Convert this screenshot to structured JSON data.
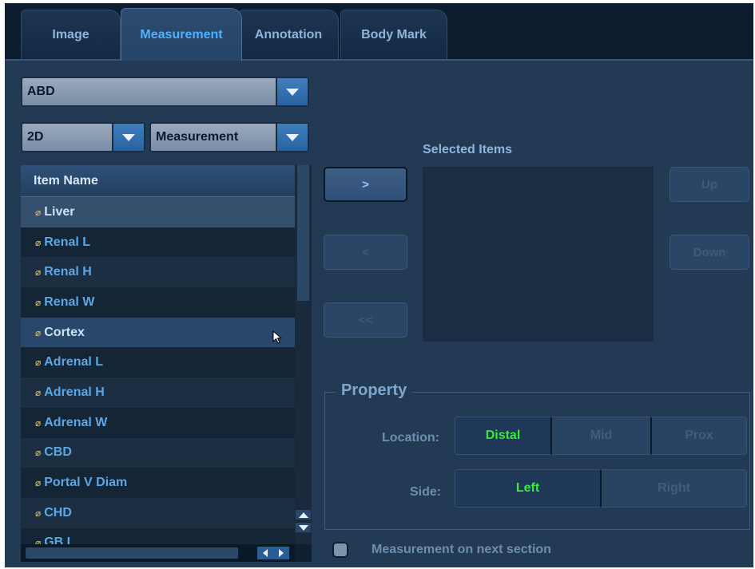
{
  "tabs": [
    {
      "label": "Image",
      "active": false
    },
    {
      "label": "Measurement",
      "active": true
    },
    {
      "label": "Annotation",
      "active": false
    },
    {
      "label": "Body Mark",
      "active": false
    }
  ],
  "exam_select": {
    "value": "ABD"
  },
  "mode_select": {
    "value": "2D"
  },
  "type_select": {
    "value": "Measurement"
  },
  "list": {
    "header": "Item Name",
    "items": [
      "Liver",
      "Renal L",
      "Renal H",
      "Renal W",
      "Cortex",
      "Adrenal L",
      "Adrenal H",
      "Adrenal W",
      "CBD",
      "Portal V Diam",
      "CHD",
      "GB L"
    ]
  },
  "buttons": {
    "add": ">",
    "remove": "<",
    "remove_all": "<<",
    "up": "Up",
    "down": "Down"
  },
  "selected_items": {
    "title": "Selected Items"
  },
  "property": {
    "title": "Property",
    "location_label": "Location:",
    "location_options": [
      "Distal",
      "Mid",
      "Prox"
    ],
    "location_selected": "Distal",
    "side_label": "Side:",
    "side_options": [
      "Left",
      "Right"
    ],
    "side_selected": "Left"
  },
  "next_section": {
    "label": "Measurement on next section",
    "checked": false
  },
  "colors": {
    "active_tab": "#4fb0ff",
    "active_option": "#33ee33",
    "panel": "#233a55"
  },
  "icons": {
    "dropdown": "chevron-down-icon",
    "list_item": "ruler-icon"
  }
}
